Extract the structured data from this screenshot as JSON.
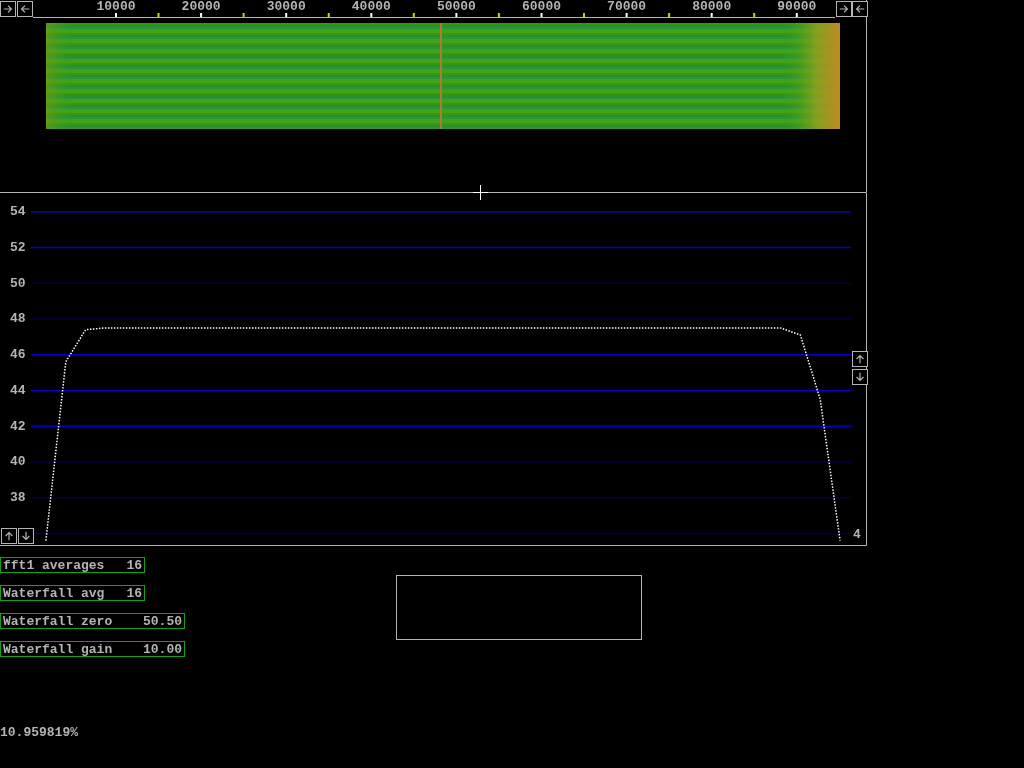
{
  "frequency_scale": {
    "labels": [
      "10000",
      "20000",
      "30000",
      "40000",
      "50000",
      "60000",
      "70000",
      "80000",
      "90000"
    ]
  },
  "spectrum": {
    "corner_label": "4",
    "chart_data": {
      "type": "line",
      "categories": [
        null,
        null,
        null,
        null,
        null,
        null,
        null,
        null,
        null,
        null,
        null,
        null,
        null,
        null,
        null,
        null,
        null,
        null,
        null,
        null,
        null,
        null,
        null,
        null,
        null,
        null,
        null,
        null,
        null,
        null,
        null,
        null,
        null,
        null,
        null,
        null,
        null,
        null,
        null,
        null,
        null
      ],
      "series": [
        {
          "color": "#ffffff",
          "line_style": "dotted",
          "values": [
            35.6,
            45.6,
            47.4,
            47.5,
            47.5,
            47.5,
            47.5,
            47.5,
            47.5,
            47.5,
            47.5,
            47.5,
            47.5,
            47.5,
            47.5,
            47.5,
            47.5,
            47.5,
            47.5,
            47.5,
            47.5,
            47.5,
            47.5,
            47.5,
            47.5,
            47.5,
            47.5,
            47.5,
            47.5,
            47.5,
            47.5,
            47.5,
            47.5,
            47.5,
            47.5,
            47.5,
            47.5,
            47.5,
            47.1,
            43.5,
            35.6
          ]
        }
      ],
      "ylim": [
        35.3,
        55.1
      ],
      "grid": true,
      "yticks": [
        54,
        52,
        50,
        48,
        46,
        44,
        42,
        40,
        38
      ]
    }
  },
  "parameters": [
    {
      "label": "fft1 averages",
      "value": "16"
    },
    {
      "label": "Waterfall avg",
      "value": "16"
    },
    {
      "label": "Waterfall zero",
      "value": "50.50"
    },
    {
      "label": "Waterfall gain",
      "value": "10.00"
    }
  ],
  "status": "10.959819%"
}
